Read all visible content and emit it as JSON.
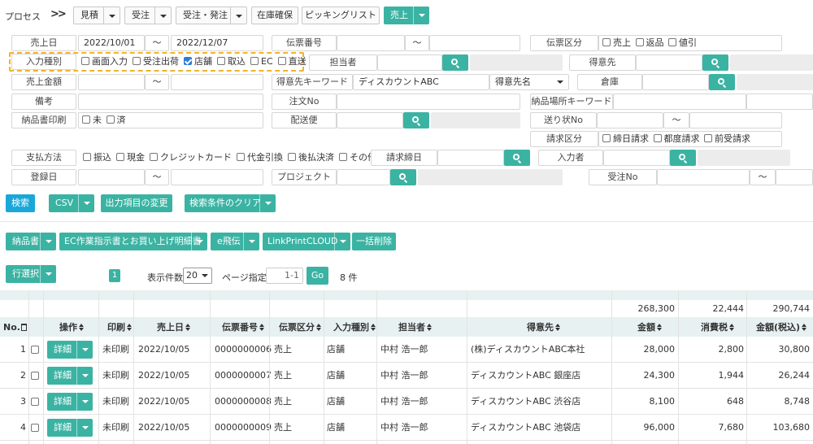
{
  "process": {
    "label": "プロセス",
    "steps": [
      "見積",
      "受注",
      "受注・発注",
      "在庫確保",
      "ピッキングリスト",
      "売上"
    ]
  },
  "form": {
    "sale_date": {
      "label": "売上日",
      "from": "2022/10/01",
      "to": "2022/12/07"
    },
    "slip_no": {
      "label": "伝票番号",
      "from": "",
      "to": ""
    },
    "slip_type": {
      "label": "伝票区分",
      "options": [
        "売上",
        "返品",
        "値引"
      ]
    },
    "input_type": {
      "label": "入力種別",
      "options": [
        {
          "label": "画面入力",
          "checked": false
        },
        {
          "label": "受注出荷",
          "checked": false
        },
        {
          "label": "店舗",
          "checked": true
        },
        {
          "label": "取込",
          "checked": false
        },
        {
          "label": "EC",
          "checked": false
        },
        {
          "label": "直送",
          "checked": false
        }
      ]
    },
    "staff": {
      "label": "担当者",
      "value": ""
    },
    "customer": {
      "label": "得意先",
      "value": ""
    },
    "amount": {
      "label": "売上金額"
    },
    "customer_keyword": {
      "label": "得意先キーワード",
      "value": "ディスカウントABC",
      "select": "得意先名"
    },
    "warehouse": {
      "label": "倉庫"
    },
    "remarks": {
      "label": "備考"
    },
    "order_no": {
      "label": "注文No"
    },
    "delivery_keyword": {
      "label": "納品場所キーワード"
    },
    "delivery_print": {
      "label": "納品書印刷",
      "options": [
        "未",
        "済"
      ]
    },
    "shipping": {
      "label": "配送便"
    },
    "invoice_no": {
      "label": "送り状No"
    },
    "billing_type": {
      "label": "請求区分",
      "options": [
        "締日請求",
        "都度請求",
        "前受請求"
      ]
    },
    "payment": {
      "label": "支払方法",
      "options": [
        "振込",
        "現金",
        "クレジットカード",
        "代金引換",
        "後払決済",
        "その他"
      ]
    },
    "billing_close": {
      "label": "請求締日"
    },
    "entry_by": {
      "label": "入力者"
    },
    "reg_date": {
      "label": "登録日"
    },
    "project": {
      "label": "プロジェクト"
    },
    "receive_no": {
      "label": "受注No"
    },
    "tilde": "～"
  },
  "actions": {
    "search": "検索",
    "csv": "CSV",
    "output_change": "出力項目の変更",
    "clear": "検索条件のクリア"
  },
  "toolbar": {
    "delivery_note": "納品書",
    "ec_instruction": "EC作業指示書とお買い上げ明細書",
    "ehiden": "e飛伝",
    "linkprint": "LinkPrintCLOUD",
    "bulk_delete": "一括削除",
    "row_select": "行選択",
    "page_badge": "1",
    "per_page_label": "表示件数",
    "per_page_value": "20",
    "page_label": "ページ指定",
    "page_value": "1-1",
    "go": "Go",
    "count": "8 件"
  },
  "totals": {
    "amount": "268,300",
    "tax": "22,444",
    "total": "290,744"
  },
  "table": {
    "headers": {
      "no": "No.",
      "op": "操作",
      "print": "印刷",
      "date": "売上日",
      "slip": "伝票番号",
      "type": "伝票区分",
      "input": "入力種別",
      "staff": "担当者",
      "customer": "得意先",
      "amount": "金額",
      "tax": "消費税",
      "total": "金額(税込)"
    },
    "detail_label": "詳細",
    "rows": [
      {
        "no": "1",
        "print": "未印刷",
        "date": "2022/10/05",
        "slip": "0000000006",
        "type": "売上",
        "input": "店舗",
        "staff": "中村 浩一郎",
        "customer": "(株)ディスカウントABC本社",
        "amount": "28,000",
        "tax": "2,800",
        "total": "30,800"
      },
      {
        "no": "2",
        "print": "未印刷",
        "date": "2022/10/05",
        "slip": "0000000007",
        "type": "売上",
        "input": "店舗",
        "staff": "中村 浩一郎",
        "customer": "ディスカウントABC 銀座店",
        "amount": "24,300",
        "tax": "1,944",
        "total": "26,244"
      },
      {
        "no": "3",
        "print": "未印刷",
        "date": "2022/10/05",
        "slip": "0000000008",
        "type": "売上",
        "input": "店舗",
        "staff": "中村 浩一郎",
        "customer": "ディスカウントABC 渋谷店",
        "amount": "8,100",
        "tax": "648",
        "total": "8,748"
      },
      {
        "no": "4",
        "print": "未印刷",
        "date": "2022/10/05",
        "slip": "0000000009",
        "type": "売上",
        "input": "店舗",
        "staff": "中村 浩一郎",
        "customer": "ディスカウントABC 池袋店",
        "amount": "96,000",
        "tax": "7,680",
        "total": "103,680"
      }
    ]
  },
  "colors": {
    "accent": "#3bb3a3",
    "search": "#1aa7d8",
    "highlight": "#f0b429",
    "checkbox_on": "#2d7cd6"
  }
}
